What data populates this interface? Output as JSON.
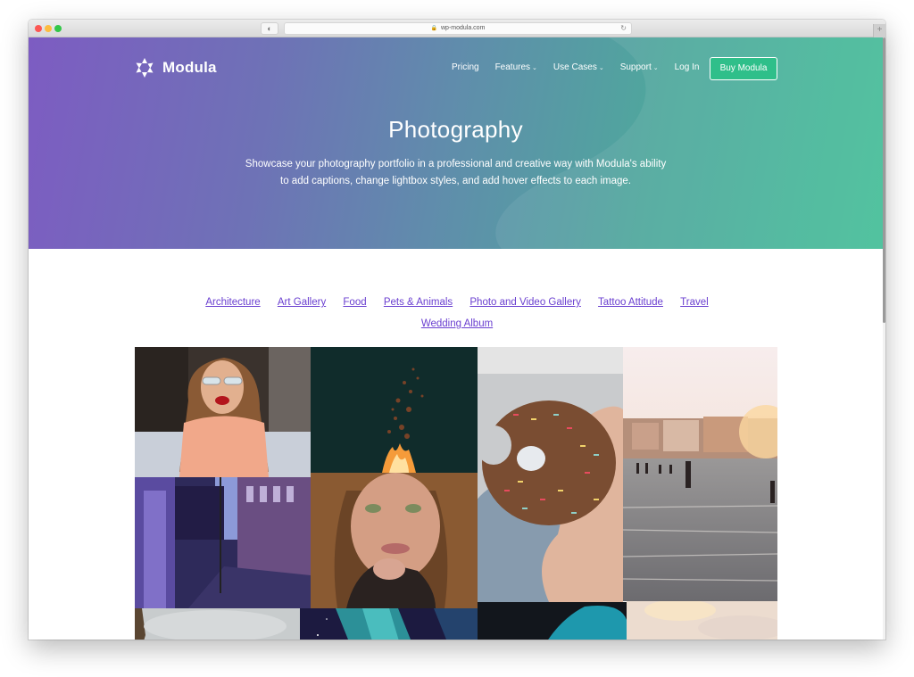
{
  "browser": {
    "url": "wp-modula.com",
    "privacy_icon": "privacy-report-icon",
    "reload_icon": "reload-icon",
    "new_tab_label": "+"
  },
  "header": {
    "brand": "Modula",
    "nav": [
      {
        "label": "Pricing",
        "has_dropdown": false
      },
      {
        "label": "Features",
        "has_dropdown": true
      },
      {
        "label": "Use Cases",
        "has_dropdown": true
      },
      {
        "label": "Support",
        "has_dropdown": true
      },
      {
        "label": "Log In",
        "has_dropdown": false
      }
    ],
    "cta": "Buy Modula"
  },
  "hero": {
    "title": "Photography",
    "subtitle": "Showcase your photography portfolio in a professional and creative way with Modula's ability to add captions, change lightbox styles, and add hover effects to each image."
  },
  "filters": [
    "Architecture",
    "Art Gallery",
    "Food",
    "Pets & Animals",
    "Photo and Video Gallery",
    "Tattoo Attitude",
    "Travel",
    "Wedding Album"
  ],
  "gallery": {
    "items": [
      {
        "name": "woman-glasses-red-lips",
        "subject": "Woman with glasses and red lipstick on a bed"
      },
      {
        "name": "sparks-fire",
        "subject": "Fire sparks against a dark background"
      },
      {
        "name": "sprinkle-donut",
        "subject": "Hand holding a bitten sprinkle donut"
      },
      {
        "name": "beach-sunset",
        "subject": "People wading into the sea at sunset"
      },
      {
        "name": "city-street-night",
        "subject": "Purple-toned city street at dusk"
      },
      {
        "name": "freckled-woman",
        "subject": "Freckled woman with hand at chin"
      },
      {
        "name": "grey-sky",
        "subject": "Grey overcast sky"
      },
      {
        "name": "aurora-night",
        "subject": "Aurora in a starry night sky"
      },
      {
        "name": "teal-abstract",
        "subject": "Dark teal abstract shape"
      },
      {
        "name": "pale-sky",
        "subject": "Pale warm sky"
      }
    ]
  },
  "colors": {
    "accent_link": "#6a3fd0",
    "cta_green": "#2fbf8a",
    "hero_start": "#7d5cc2",
    "hero_end": "#45bf98"
  }
}
